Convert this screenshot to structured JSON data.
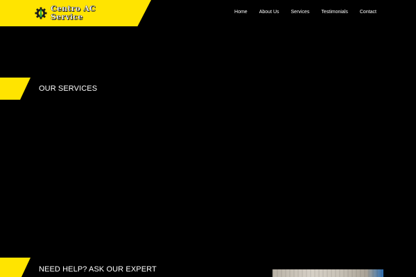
{
  "header": {
    "logo_text": "Centro AC\nService",
    "nav": [
      {
        "label": "Home"
      },
      {
        "label": "About Us"
      },
      {
        "label": "Services"
      },
      {
        "label": "Testimonials"
      },
      {
        "label": "Contact"
      }
    ]
  },
  "sections": {
    "services_title": "OUR SERVICES",
    "help_title": "NEED HELP? ASK OUR EXPERT"
  },
  "colors": {
    "accent": "#ffe400",
    "background": "#000000",
    "text": "#ffffff"
  },
  "icons": {
    "logo_icon": "gear-wrench-icon"
  }
}
